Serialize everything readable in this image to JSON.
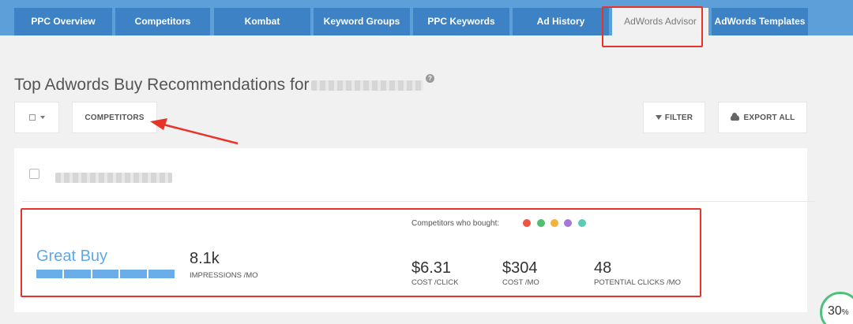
{
  "tabs": [
    {
      "label": "PPC Overview"
    },
    {
      "label": "Competitors"
    },
    {
      "label": "Kombat"
    },
    {
      "label": "Keyword Groups"
    },
    {
      "label": "PPC Keywords"
    },
    {
      "label": "Ad History"
    },
    {
      "label": "AdWords Advisor",
      "active": true
    },
    {
      "label": "AdWords Templates"
    }
  ],
  "page": {
    "title": "Top Adwords Buy Recommendations for",
    "help_icon": "?"
  },
  "toolbar": {
    "select_icon": "checkbox-icon",
    "competitors_label": "COMPETITORS",
    "filter_label": "FILTER",
    "export_label": "EXPORT ALL"
  },
  "recommendation": {
    "advertiser": "Great Buy",
    "competitors_label": "Competitors who bought:",
    "competitor_colors": [
      "#ef5343",
      "#4fbf6f",
      "#f3b23c",
      "#a679d9",
      "#5ccdb5"
    ],
    "impressions": {
      "value": "8.1k",
      "label": "IMPRESSIONS /MO"
    },
    "cost_per_click": {
      "value": "$6.31",
      "label": "COST /CLICK"
    },
    "cost_per_month": {
      "value": "$304",
      "label": "COST /MO"
    },
    "potential_clicks": {
      "value": "48",
      "label": "POTENTIAL CLICKS /MO"
    }
  },
  "gauge": {
    "value": "30",
    "unit": "%"
  },
  "colors": {
    "tab_bar": "#5d9fd8",
    "tab": "#3d82c4",
    "accent_link": "#5fa9e6",
    "annotation": "#e8332a"
  }
}
